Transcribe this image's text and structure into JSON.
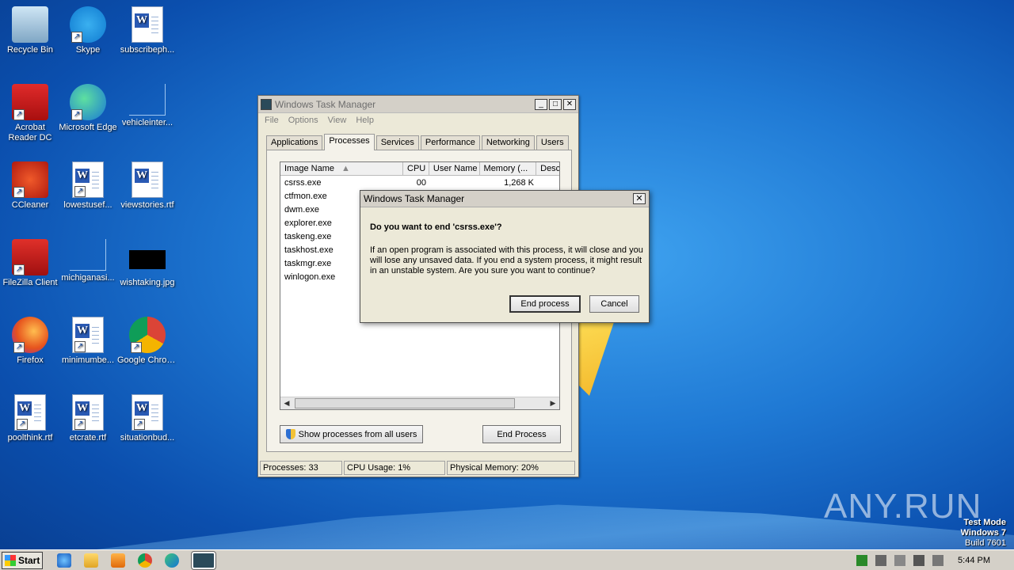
{
  "desktop": {
    "icons": [
      {
        "label": "Recycle Bin",
        "icon": "recycle-bin-icon"
      },
      {
        "label": "Skype",
        "icon": "skype-icon"
      },
      {
        "label": "subscribeph...",
        "icon": "word-doc-icon"
      },
      {
        "label": "Acrobat Reader DC",
        "icon": "acrobat-icon"
      },
      {
        "label": "Microsoft Edge",
        "icon": "edge-icon"
      },
      {
        "label": "vehicleinter...",
        "icon": "blank-file-icon"
      },
      {
        "label": "CCleaner",
        "icon": "ccleaner-icon"
      },
      {
        "label": "lowestusef...",
        "icon": "word-doc-icon"
      },
      {
        "label": "viewstories.rtf",
        "icon": "word-doc-icon"
      },
      {
        "label": "FileZilla Client",
        "icon": "filezilla-icon"
      },
      {
        "label": "michiganasi...",
        "icon": "blank-file-icon"
      },
      {
        "label": "wishtaking.jpg",
        "icon": "image-file-icon"
      },
      {
        "label": "Firefox",
        "icon": "firefox-icon"
      },
      {
        "label": "minimumbe...",
        "icon": "word-doc-icon"
      },
      {
        "label": "Google Chrome",
        "icon": "chrome-icon"
      },
      {
        "label": "poolthink.rtf",
        "icon": "word-doc-icon"
      },
      {
        "label": "etcrate.rtf",
        "icon": "word-doc-icon"
      },
      {
        "label": "situationbud...",
        "icon": "word-doc-icon"
      }
    ],
    "watermark": {
      "line1": "Test Mode",
      "line2": "Windows 7",
      "line3": "Build 7601"
    },
    "brand": "ANY.RUN"
  },
  "task_manager": {
    "title": "Windows Task Manager",
    "menu": [
      "File",
      "Options",
      "View",
      "Help"
    ],
    "tabs": [
      "Applications",
      "Processes",
      "Services",
      "Performance",
      "Networking",
      "Users"
    ],
    "active_tab": "Processes",
    "columns": {
      "name": "Image Name",
      "cpu": "CPU",
      "user": "User Name",
      "mem": "Memory (...",
      "desc": "Desc"
    },
    "rows": [
      {
        "name": "csrss.exe",
        "cpu": "00",
        "user": "",
        "mem": "1,268 K"
      },
      {
        "name": "ctfmon.exe"
      },
      {
        "name": "dwm.exe"
      },
      {
        "name": "explorer.exe"
      },
      {
        "name": "taskeng.exe"
      },
      {
        "name": "taskhost.exe"
      },
      {
        "name": "taskmgr.exe"
      },
      {
        "name": "winlogon.exe"
      }
    ],
    "show_all_button": "Show processes from all users",
    "end_process_button": "End Process",
    "status": {
      "processes": "Processes: 33",
      "cpu": "CPU Usage: 1%",
      "memory": "Physical Memory: 20%"
    }
  },
  "dialog": {
    "title": "Windows Task Manager",
    "question": "Do you want to end 'csrss.exe'?",
    "message": "If an open program is associated with this process, it will close and you will lose any unsaved data. If you end a system process, it might result in an unstable system. Are you sure you want to continue?",
    "confirm": "End process",
    "cancel": "Cancel"
  },
  "taskbar": {
    "start": "Start",
    "clock": "5:44 PM"
  },
  "colors": {
    "desktop": "#1f79d4",
    "window": "#ece9d8",
    "titlebar": "#d4d0c8"
  }
}
